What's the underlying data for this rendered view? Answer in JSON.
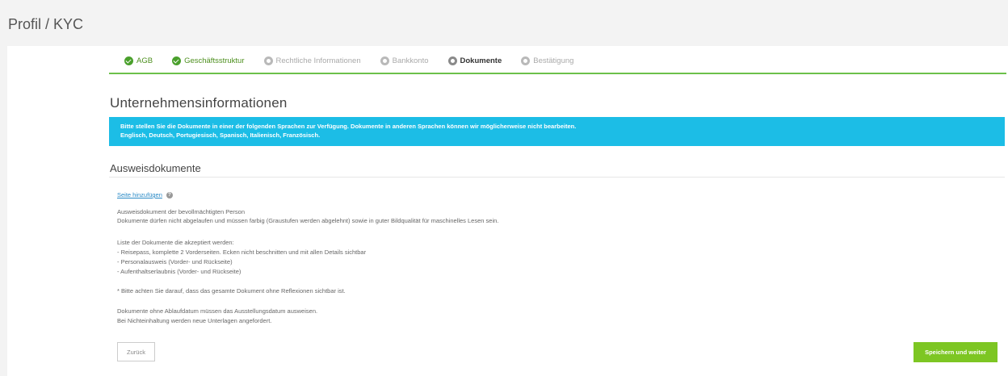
{
  "page": {
    "title": "Profil / KYC"
  },
  "steps": [
    {
      "label": "AGB",
      "state": "done"
    },
    {
      "label": "Geschäftsstruktur",
      "state": "done"
    },
    {
      "label": "Rechtliche Informationen",
      "state": "todo"
    },
    {
      "label": "Bankkonto",
      "state": "todo"
    },
    {
      "label": "Dokumente",
      "state": "active"
    },
    {
      "label": "Bestätigung",
      "state": "todo"
    }
  ],
  "section": {
    "title": "Unternehmensinformationen"
  },
  "banner": {
    "line1": "Bitte stellen Sie die Dokumente in einer der folgenden Sprachen zur Verfügung. Dokumente in anderen Sprachen können wir möglicherweise nicht bearbeiten.",
    "line2": "Englisch, Deutsch, Portugiesisch, Spanisch, Italienisch, Französisch."
  },
  "documents": {
    "title": "Ausweisdokumente",
    "add_page_label": "Seite hinzufügen",
    "help_icon": "help-icon",
    "lines": [
      "Ausweisdokument der bevollmächtigten Person",
      "Dokumente dürfen nicht abgelaufen und müssen farbig (Graustufen werden abgelehnt) sowie in guter Bildqualität für maschinelles Lesen sein.",
      "",
      "Liste der Dokumente die akzeptiert werden:",
      "- Reisepass, komplette 2 Vorderseiten. Ecken nicht beschnitten und mit allen Details sichtbar",
      "- Personalausweis (Vorder- und Rückseite)",
      "- Aufenthaltserlaubnis (Vorder- und Rückseite)",
      "",
      "* Bitte achten Sie darauf, dass das gesamte Dokument ohne Reflexionen sichtbar ist.",
      "",
      "Dokumente ohne Ablaufdatum müssen das Ausstellungsdatum ausweisen.",
      "Bei Nichteinhaltung werden neue Unterlagen angefordert."
    ]
  },
  "buttons": {
    "back": "Zurück",
    "save": "Speichern und weiter"
  },
  "colors": {
    "accent": "#7dc623",
    "banner": "#1cbde6",
    "done": "#4aa02c"
  }
}
